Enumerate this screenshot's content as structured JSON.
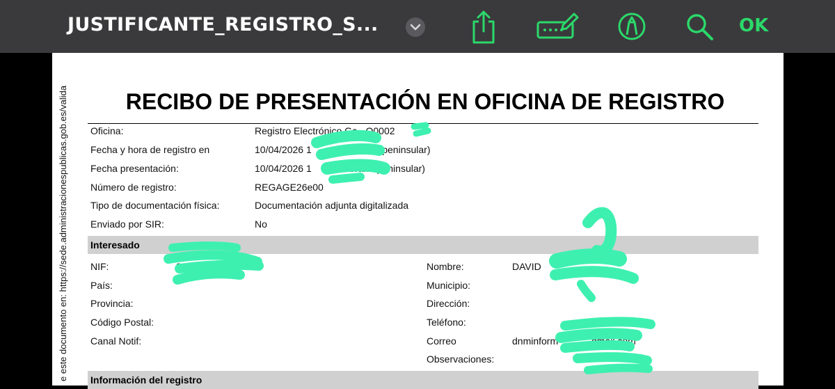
{
  "toolbar": {
    "title": "JUSTIFICANTE_REGISTRO_S...",
    "ok_label": "OK",
    "accent": "#2bd96a",
    "icons": [
      "chevron-down-icon",
      "share-icon",
      "keyboard-pen-icon",
      "markup-pen-icon",
      "search-icon"
    ]
  },
  "document": {
    "title": "RECIBO DE PRESENTACIÓN EN OFICINA DE REGISTRO",
    "side_text": "e este documento en: https://sede.administracionespublicas.gob.es/valida",
    "fields": [
      {
        "label": "Oficina:",
        "value": "Registro Electrónico Gc - O0002"
      },
      {
        "label": "Fecha y hora de registro en",
        "value": "10/04/2026 1",
        "value_tail": "ario peninsular)"
      },
      {
        "label": "Fecha presentación:",
        "value": "10/04/2026 1",
        "value_tail": "orario peninsular)"
      },
      {
        "label": "Número de registro:",
        "value": "REGAGE26e00"
      },
      {
        "label": "Tipo de documentación física:",
        "value": "Documentación adjunta digitalizada"
      },
      {
        "label": "Enviado por SIR:",
        "value": "No"
      }
    ],
    "interesado": {
      "header": "Interesado",
      "left": [
        {
          "label": "NIF:",
          "value": "2"
        },
        {
          "label": "País:",
          "value": ""
        },
        {
          "label": "Provincia:",
          "value": ""
        },
        {
          "label": "Código Postal:",
          "value": ""
        },
        {
          "label": "Canal Notif:",
          "value": ""
        }
      ],
      "right": [
        {
          "label": "Nombre:",
          "value": "DAVID"
        },
        {
          "label": "Municipio:",
          "value": ""
        },
        {
          "label": "Dirección:",
          "value": ""
        },
        {
          "label": "Teléfono:",
          "value": ""
        },
        {
          "label": "Correo",
          "value": "dnminform",
          "value_tail": "gmail.com"
        },
        {
          "label": "Observaciones:",
          "value": ""
        }
      ]
    },
    "next_section": "Información del registro",
    "redaction_color": "#3ef0b0"
  }
}
